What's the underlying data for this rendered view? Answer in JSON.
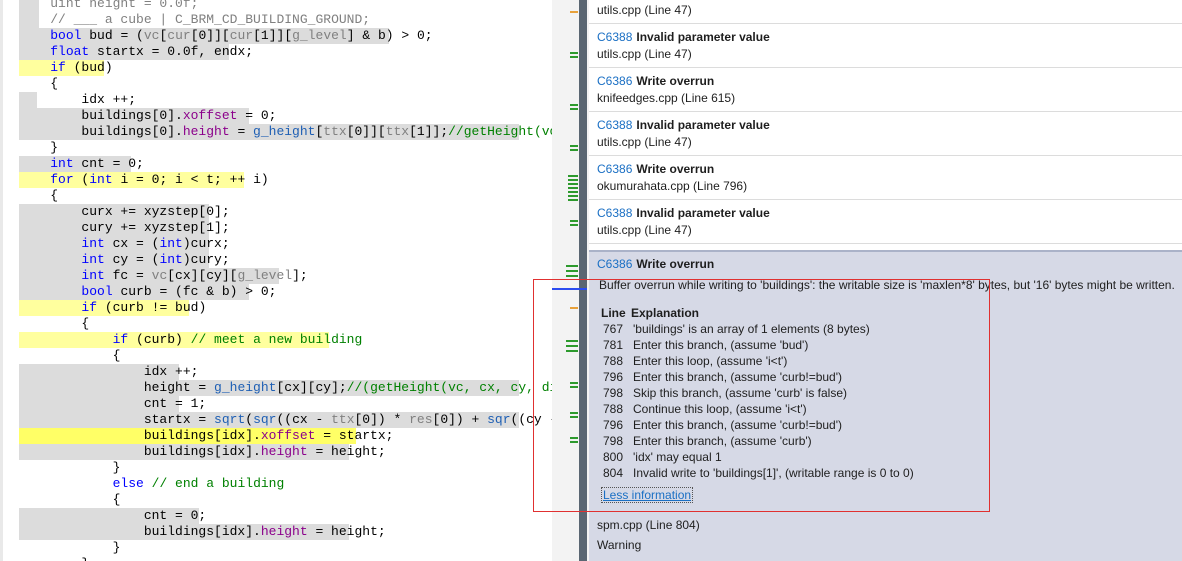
{
  "editor": {
    "lines": [
      {
        "parts": [
          [
            "    ",
            "gr"
          ],
          [
            "uint height = 0.0f;",
            "gr"
          ]
        ],
        "bg": "hl-gray"
      },
      {
        "parts": [
          [
            "    ",
            "gr"
          ],
          [
            "// ___ a cube | C_BRM_CD_BUILDING_GROUND;",
            "gr"
          ]
        ],
        "bg": "hl-gray"
      },
      {
        "parts": [
          [
            "    "
          ],
          [
            "bool",
            "kw"
          ],
          [
            " bud = ("
          ],
          [
            "vc",
            "gr"
          ],
          [
            "["
          ],
          [
            "cur",
            "gr"
          ],
          [
            "[0]]["
          ],
          [
            "cur",
            "gr"
          ],
          [
            "[1]]["
          ],
          [
            "g_level",
            "gr"
          ],
          [
            "] & b) > 0;"
          ]
        ],
        "bg": "hl-gray"
      },
      {
        "parts": [
          [
            "    "
          ],
          [
            "float",
            "kw"
          ],
          [
            " startx = 0.0f, endx;"
          ]
        ],
        "bg": "hl-gray"
      },
      {
        "parts": [
          [
            "    "
          ],
          [
            "if",
            "kw"
          ],
          [
            " (bud)"
          ]
        ],
        "bg": "hl-yellow"
      },
      {
        "parts": [
          [
            "    {"
          ]
        ],
        "bg": ""
      },
      {
        "parts": [
          [
            "        idx ++;"
          ]
        ],
        "bg": "hl-gray"
      },
      {
        "parts": [
          [
            "        buildings[0]."
          ],
          [
            "xoffset",
            "mb"
          ],
          [
            " = 0;"
          ]
        ],
        "bg": "hl-gray"
      },
      {
        "parts": [
          [
            "        buildings[0]."
          ],
          [
            "height",
            "mb"
          ],
          [
            " = "
          ],
          [
            "g_height",
            "fn"
          ],
          [
            "["
          ],
          [
            "ttx",
            "gr"
          ],
          [
            "[0]]["
          ],
          [
            "ttx",
            "gr"
          ],
          [
            "[1]];"
          ],
          [
            "//getHeight(vc,",
            "cm"
          ]
        ],
        "bg": "hl-gray"
      },
      {
        "parts": [
          [
            "    }"
          ]
        ],
        "bg": ""
      },
      {
        "parts": [
          [
            "    "
          ],
          [
            "int",
            "kw"
          ],
          [
            " cnt = 0;"
          ]
        ],
        "bg": "hl-gray"
      },
      {
        "parts": [
          [
            "    "
          ],
          [
            "for",
            "kw"
          ],
          [
            " ("
          ],
          [
            "int",
            "kw"
          ],
          [
            " i = 0; i < t; ++ i)"
          ]
        ],
        "bg": "hl-yellow"
      },
      {
        "parts": [
          [
            "    {"
          ]
        ],
        "bg": ""
      },
      {
        "parts": [
          [
            "        curx += xyzstep[0];"
          ]
        ],
        "bg": "hl-gray"
      },
      {
        "parts": [
          [
            "        cury += xyzstep[1];"
          ]
        ],
        "bg": "hl-gray"
      },
      {
        "parts": [
          [
            "        "
          ],
          [
            "int",
            "kw"
          ],
          [
            " cx = ("
          ],
          [
            "int",
            "kw"
          ],
          [
            ")curx;"
          ]
        ],
        "bg": "hl-gray"
      },
      {
        "parts": [
          [
            "        "
          ],
          [
            "int",
            "kw"
          ],
          [
            " cy = ("
          ],
          [
            "int",
            "kw"
          ],
          [
            ")cury;"
          ]
        ],
        "bg": "hl-gray"
      },
      {
        "parts": [
          [
            "        "
          ],
          [
            "int",
            "kw"
          ],
          [
            " fc = "
          ],
          [
            "vc",
            "gr"
          ],
          [
            "[cx][cy]["
          ],
          [
            "g_level",
            "gr"
          ],
          [
            "];"
          ]
        ],
        "bg": "hl-gray"
      },
      {
        "parts": [
          [
            "        "
          ],
          [
            "bool",
            "kw"
          ],
          [
            " curb = (fc & b) > 0;"
          ]
        ],
        "bg": "hl-gray"
      },
      {
        "parts": [
          [
            "        "
          ],
          [
            "if",
            "kw"
          ],
          [
            " (curb != bud)"
          ]
        ],
        "bg": "hl-yellow"
      },
      {
        "parts": [
          [
            "        {"
          ]
        ],
        "bg": ""
      },
      {
        "parts": [
          [
            "            "
          ],
          [
            "if",
            "kw"
          ],
          [
            " (curb) "
          ],
          [
            "// meet a new building",
            "cm"
          ]
        ],
        "bg": "hl-yellow"
      },
      {
        "parts": [
          [
            "            {"
          ]
        ],
        "bg": ""
      },
      {
        "parts": [
          [
            "                idx ++;"
          ]
        ],
        "bg": "hl-gray"
      },
      {
        "parts": [
          [
            "                height = "
          ],
          [
            "g_height",
            "fn"
          ],
          [
            "[cx][cy];"
          ],
          [
            "//(getHeight(vc, cx, cy, dim,",
            "cm"
          ]
        ],
        "bg": "hl-gray"
      },
      {
        "parts": [
          [
            "                cnt = 1;"
          ]
        ],
        "bg": "hl-gray"
      },
      {
        "parts": [
          [
            "                startx = "
          ],
          [
            "sqrt",
            "fn"
          ],
          [
            "("
          ],
          [
            "sqr",
            "fn"
          ],
          [
            "((cx - "
          ],
          [
            "ttx",
            "gr"
          ],
          [
            "[0]) * "
          ],
          [
            "res",
            "gr"
          ],
          [
            "[0]) + "
          ],
          [
            "sqr",
            "fn"
          ],
          [
            "((cy - t"
          ]
        ],
        "bg": "hl-gray"
      },
      {
        "parts": [
          [
            "                buildings[idx]."
          ],
          [
            "xoffset",
            "mb"
          ],
          [
            " = startx;"
          ]
        ],
        "bg": "hl-yellow-strong"
      },
      {
        "parts": [
          [
            "                buildings[idx]."
          ],
          [
            "height",
            "mb"
          ],
          [
            " = height;"
          ]
        ],
        "bg": "hl-gray"
      },
      {
        "parts": [
          [
            "            }"
          ]
        ],
        "bg": ""
      },
      {
        "parts": [
          [
            "            "
          ],
          [
            "else",
            "kw"
          ],
          [
            " "
          ],
          [
            "// end a building",
            "cm"
          ]
        ],
        "bg": ""
      },
      {
        "parts": [
          [
            "            {"
          ]
        ],
        "bg": ""
      },
      {
        "parts": [
          [
            "                cnt = 0;"
          ]
        ],
        "bg": "hl-gray"
      },
      {
        "parts": [
          [
            "                buildings[idx]."
          ],
          [
            "height",
            "mb"
          ],
          [
            " = height;"
          ]
        ],
        "bg": "hl-gray"
      },
      {
        "parts": [
          [
            "            }"
          ]
        ],
        "bg": ""
      },
      {
        "parts": [
          [
            "        }"
          ]
        ],
        "bg": ""
      }
    ]
  },
  "errors": {
    "items": [
      {
        "code": "",
        "title": "Invalid parameter value",
        "file": "utils.cpp (Line 47)"
      },
      {
        "code": "C6388",
        "title": "Invalid parameter value",
        "file": "utils.cpp (Line 47)"
      },
      {
        "code": "C6386",
        "title": "Write overrun",
        "file": "knifeedges.cpp (Line 615)"
      },
      {
        "code": "C6388",
        "title": "Invalid parameter value",
        "file": "utils.cpp (Line 47)"
      },
      {
        "code": "C6386",
        "title": "Write overrun",
        "file": "okumurahata.cpp (Line 796)"
      },
      {
        "code": "C6388",
        "title": "Invalid parameter value",
        "file": "utils.cpp (Line 47)"
      }
    ],
    "expanded": {
      "code": "C6386",
      "title": "Write overrun",
      "message": "Buffer overrun while writing to 'buildings':  the writable size is 'maxlen*8' bytes, but '16' bytes might be written.",
      "header_line": "Line",
      "header_expl": "Explanation",
      "rows": [
        {
          "line": "767",
          "text": "'buildings' is an array of 1 elements (8 bytes)"
        },
        {
          "line": "781",
          "text": "Enter this branch, (assume 'bud')"
        },
        {
          "line": "788",
          "text": "Enter this loop, (assume 'i<t')"
        },
        {
          "line": "796",
          "text": "Enter this branch, (assume 'curb!=bud')"
        },
        {
          "line": "798",
          "text": "Skip this branch, (assume 'curb' is false)"
        },
        {
          "line": "788",
          "text": "Continue this loop, (assume 'i<t')"
        },
        {
          "line": "796",
          "text": "Enter this branch, (assume 'curb!=bud')"
        },
        {
          "line": "798",
          "text": "Enter this branch, (assume 'curb')"
        },
        {
          "line": "800",
          "text": "'idx' may equal 1"
        },
        {
          "line": "804",
          "text": "Invalid write to 'buildings[1]', (writable range is 0 to 0)"
        }
      ],
      "less_link": "Less information",
      "file": "spm.cpp (Line 804)",
      "severity": "Warning"
    }
  },
  "colors": {
    "keyword": "#0000ff",
    "comment": "#008000",
    "highlight_yellow": "#ffff9e",
    "highlight_gray": "#dcdcdc",
    "annotation_red": "#e03030"
  }
}
